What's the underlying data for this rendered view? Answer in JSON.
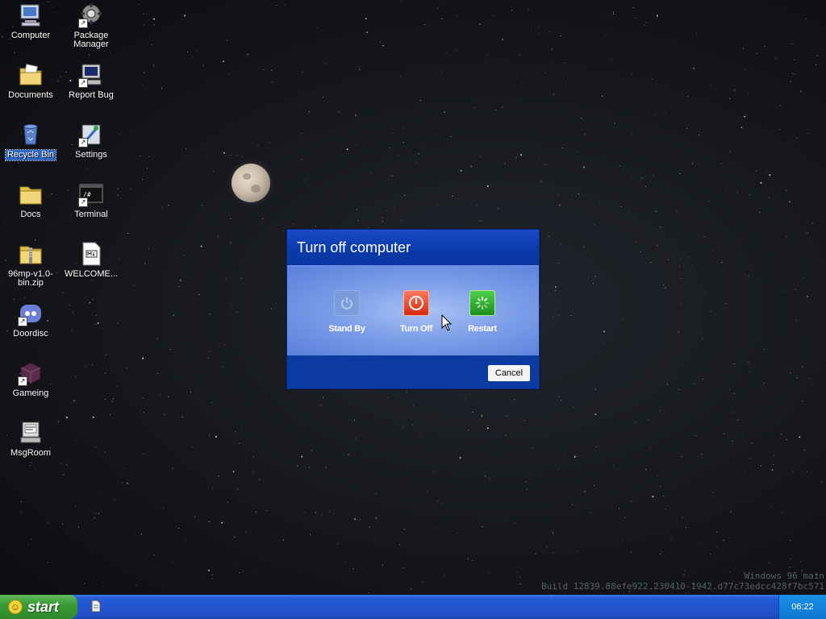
{
  "desktop": {
    "icons": [
      {
        "label": "Computer"
      },
      {
        "label": "Package Manager"
      },
      {
        "label": "Documents"
      },
      {
        "label": "Report Bug"
      },
      {
        "label": "Recycle Bin"
      },
      {
        "label": "Settings"
      },
      {
        "label": "Docs"
      },
      {
        "label": "Terminal"
      },
      {
        "label": "96mp-v1.0-bin.zip"
      },
      {
        "label": "WELCOME..."
      },
      {
        "label": "Doordisc"
      },
      {
        "label": "Gameing"
      },
      {
        "label": "MsgRoom"
      }
    ],
    "selected_icon": "Recycle Bin",
    "watermark_line1": "Windows 96 main",
    "watermark_line2": "Build 12839.88efe922.230410-1942.d77c73edcc428f7bc571"
  },
  "dialog": {
    "title": "Turn off computer",
    "options": [
      {
        "label": "Stand By",
        "icon": "power-icon",
        "state": "disabled",
        "color": "#7a9bd8"
      },
      {
        "label": "Turn Off",
        "icon": "power-icon",
        "color": "#d52a10"
      },
      {
        "label": "Restart",
        "icon": "restart-icon",
        "color": "#1d8f1b"
      }
    ],
    "cancel_label": "Cancel"
  },
  "taskbar": {
    "start_label": "start",
    "clock": "06:22",
    "color": "#2150c9"
  }
}
